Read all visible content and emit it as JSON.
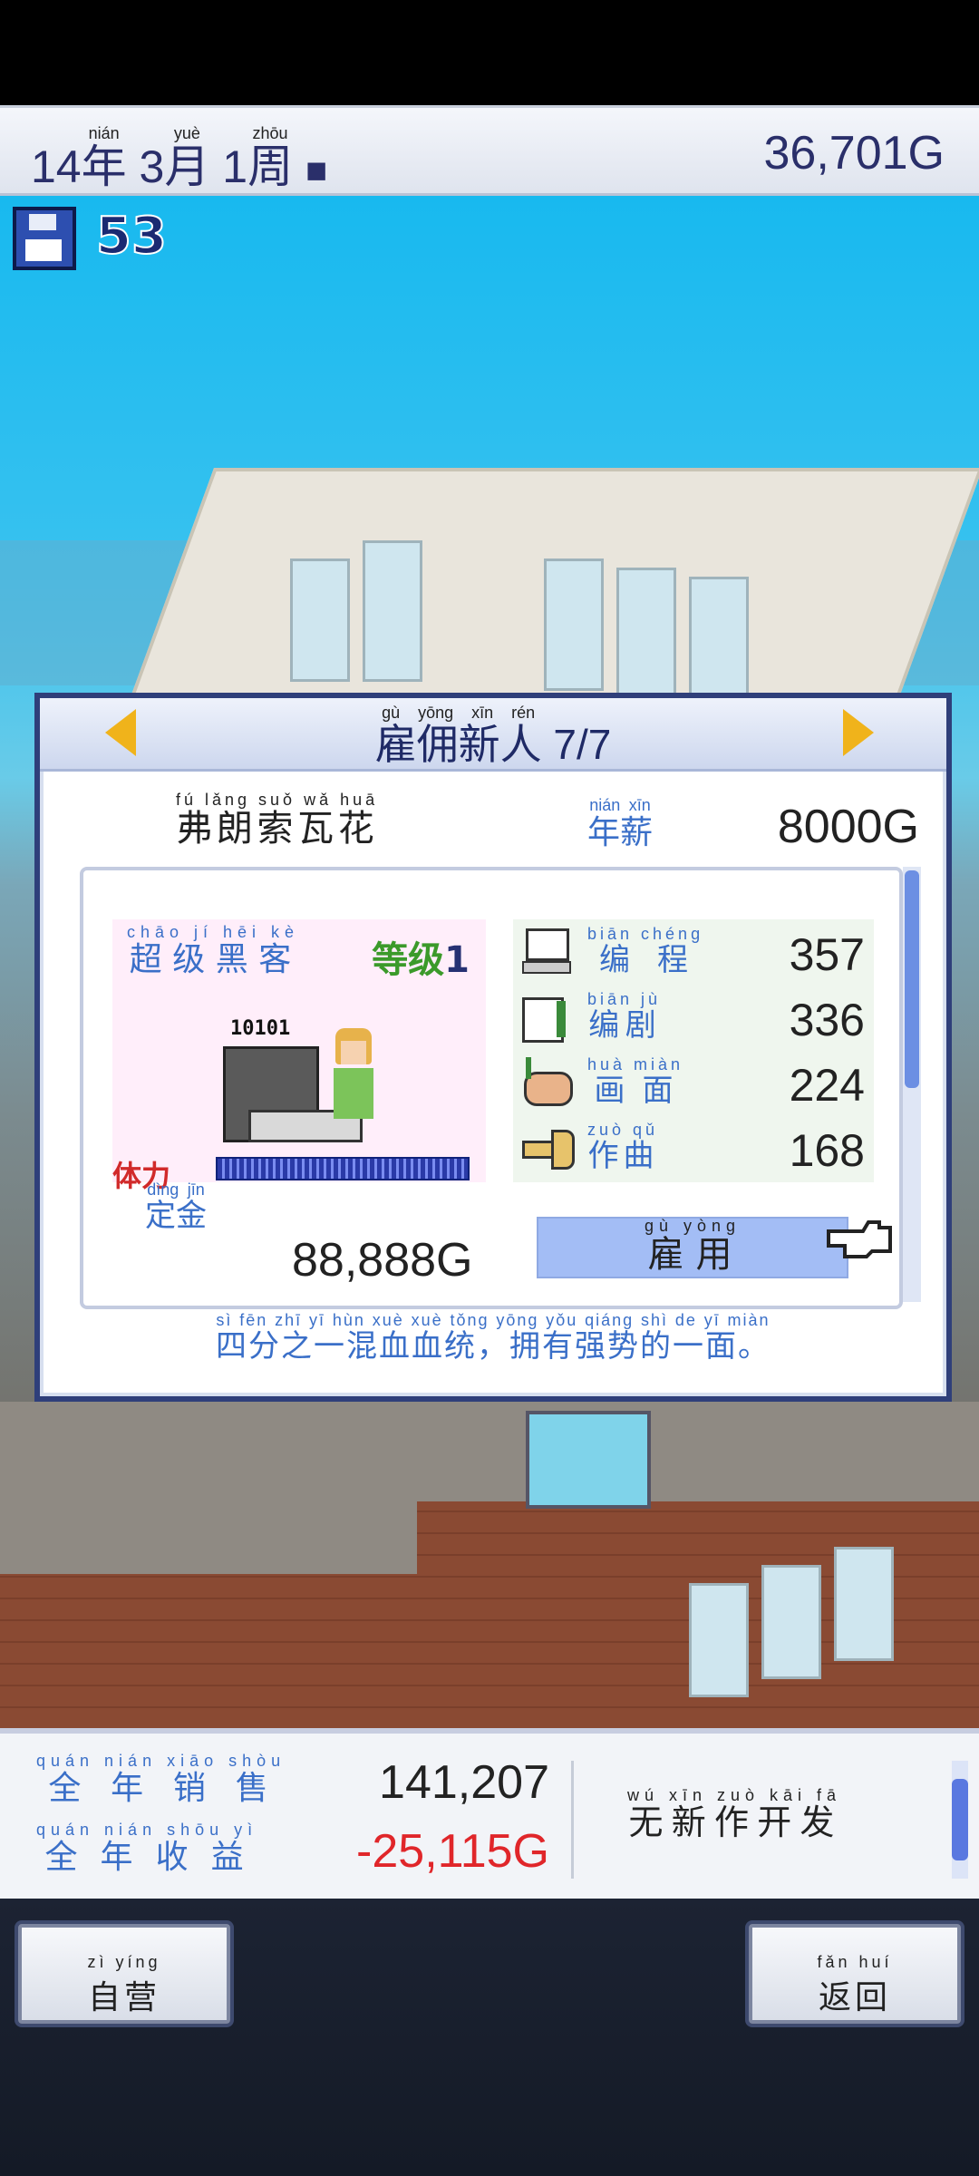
{
  "top_bar": {
    "year": "14",
    "year_unit": "年",
    "year_pinyin": "nián",
    "month": "3",
    "month_unit": "月",
    "month_pinyin": "yuè",
    "week": "1",
    "week_unit": "周",
    "week_pinyin": "zhōu",
    "money": "36,701G"
  },
  "hud": {
    "save_count": "53"
  },
  "dialog": {
    "title": "雇佣新人",
    "title_pinyin": "gù yōng xīn rén",
    "title_counter": "7/7",
    "candidate_name": "弗朗索瓦花",
    "candidate_name_pinyin": "fú lǎng suǒ wǎ huā",
    "salary_label": "年薪",
    "salary_label_pinyin": "nián xīn",
    "salary": "8000G",
    "class_name": "超级黑客",
    "class_name_pinyin": "chāo jí hēi kè",
    "level_label": "等级",
    "level": "1",
    "monitor_text": "10101",
    "stamina_label": "体力",
    "stamina_level": 1.0,
    "stats": [
      {
        "label": "编程",
        "pinyin": "biān chéng",
        "value": "357",
        "icon": "computer-icon"
      },
      {
        "label": "编剧",
        "pinyin": "biān jù",
        "value": "336",
        "icon": "book-icon"
      },
      {
        "label": "画面",
        "pinyin": "huà miàn",
        "value": "224",
        "icon": "palette-icon"
      },
      {
        "label": "作曲",
        "pinyin": "zuò qǔ",
        "value": "168",
        "icon": "trumpet-icon"
      }
    ],
    "signing_fee_label": "定金",
    "signing_fee_label_pinyin": "dìng jīn",
    "signing_fee": "88,888G",
    "hire_button": "雇用",
    "hire_button_pinyin": "gù yòng",
    "description": "四分之一混血血统，拥有强势的一面。",
    "description_pinyin": "sì fēn zhī yī hùn xuè xuè tǒng yōng yǒu qiáng shì de yī miàn"
  },
  "summary": {
    "annual_sales_label": "全年销售",
    "annual_sales_label_pinyin": "quán nián xiāo shòu",
    "annual_sales": "141,207",
    "annual_profit_label": "全年收益",
    "annual_profit_label_pinyin": "quán nián shōu yì",
    "annual_profit": "-25,115G",
    "status": "无新作开发",
    "status_pinyin": "wú xīn zuò kāi fā"
  },
  "nav": {
    "left_button": "自营",
    "left_button_pinyin": "zì yíng",
    "right_button": "返回",
    "right_button_pinyin": "fǎn huí"
  }
}
